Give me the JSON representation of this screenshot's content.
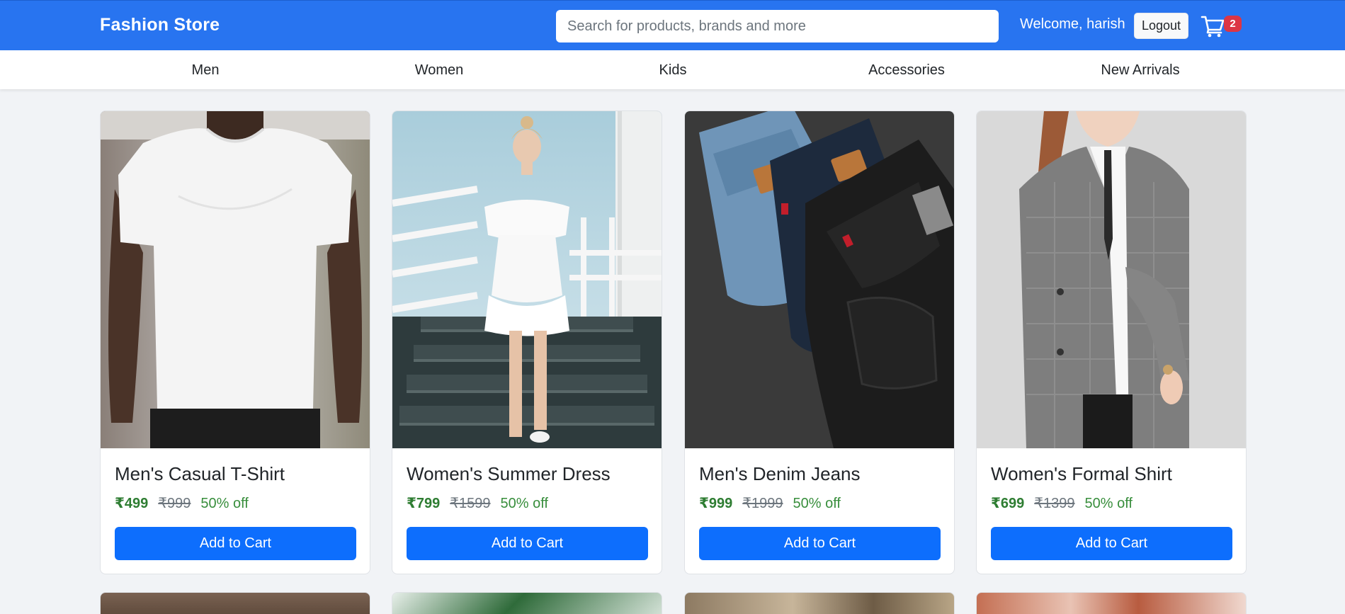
{
  "header": {
    "brand": "Fashion Store",
    "search_placeholder": "Search for products, brands and more",
    "welcome": "Welcome, harish",
    "logout_label": "Logout",
    "cart_count": "2",
    "cart_icon": "shopping-cart-icon",
    "accent": "#2874f0"
  },
  "categories": [
    "Men",
    "Women",
    "Kids",
    "Accessories",
    "New Arrivals"
  ],
  "products": [
    {
      "title": "Men's Casual T-Shirt",
      "price": "₹499",
      "mrp": "₹999",
      "discount": "50% off",
      "button": "Add to Cart"
    },
    {
      "title": "Women's Summer Dress",
      "price": "₹799",
      "mrp": "₹1599",
      "discount": "50% off",
      "button": "Add to Cart"
    },
    {
      "title": "Men's Denim Jeans",
      "price": "₹999",
      "mrp": "₹1999",
      "discount": "50% off",
      "button": "Add to Cart"
    },
    {
      "title": "Women's Formal Shirt",
      "price": "₹699",
      "mrp": "₹1399",
      "discount": "50% off",
      "button": "Add to Cart"
    }
  ],
  "colors": {
    "button": "#0d6efd",
    "price": "#2e7d32",
    "badge": "#dc3545",
    "page_bg": "#f1f3f6"
  }
}
